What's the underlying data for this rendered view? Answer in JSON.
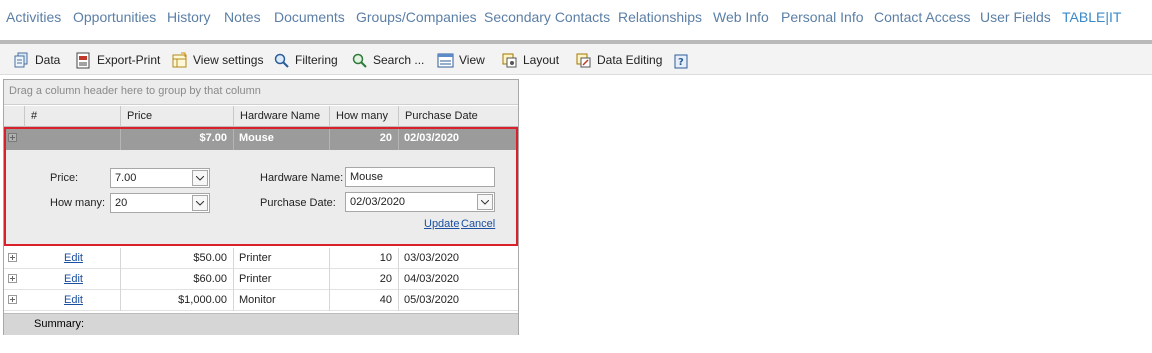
{
  "nav": {
    "tabs": [
      {
        "label": "Activities"
      },
      {
        "label": "Opportunities"
      },
      {
        "label": "History"
      },
      {
        "label": "Notes"
      },
      {
        "label": "Documents"
      },
      {
        "label": "Groups/Companies"
      },
      {
        "label": "Secondary Contacts"
      },
      {
        "label": "Relationships"
      },
      {
        "label": "Web Info"
      },
      {
        "label": "Personal Info"
      },
      {
        "label": "Contact Access"
      },
      {
        "label": "User Fields"
      },
      {
        "label": "TABLE|IT"
      }
    ]
  },
  "toolbar": {
    "data": "Data",
    "export": "Export-Print",
    "view_settings": "View settings",
    "filtering": "Filtering",
    "search": "Search ...",
    "view": "View",
    "layout": "Layout",
    "data_editing": "Data Editing"
  },
  "grid": {
    "group_hint": "Drag a column header here to group by that column",
    "columns": {
      "num": "#",
      "price": "Price",
      "hardware": "Hardware Name",
      "howmany": "How many",
      "date": "Purchase Date"
    },
    "selected": {
      "price": "$7.00",
      "hardware": "Mouse",
      "howmany": "20",
      "date": "02/03/2020"
    },
    "edit_form": {
      "price_label": "Price:",
      "price_value": "7.00",
      "howmany_label": "How many:",
      "howmany_value": "20",
      "hardware_label": "Hardware Name:",
      "hardware_value": "Mouse",
      "date_label": "Purchase Date:",
      "date_value": "02/03/2020",
      "update": "Update",
      "cancel": "Cancel"
    },
    "rows": [
      {
        "edit": "Edit",
        "price": "$50.00",
        "hardware": "Printer",
        "howmany": "10",
        "date": "03/03/2020"
      },
      {
        "edit": "Edit",
        "price": "$60.00",
        "hardware": "Printer",
        "howmany": "20",
        "date": "04/03/2020"
      },
      {
        "edit": "Edit",
        "price": "$1,000.00",
        "hardware": "Monitor",
        "howmany": "40",
        "date": "05/03/2020"
      }
    ],
    "summary_label": "Summary:"
  }
}
